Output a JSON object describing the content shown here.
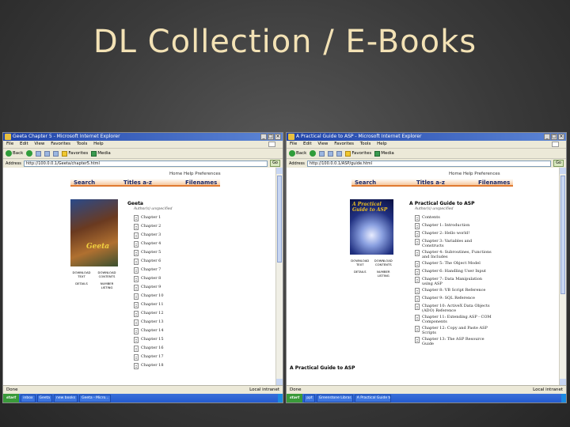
{
  "slide": {
    "title": "DL Collection / E-Books"
  },
  "browser_common": {
    "menu": [
      "File",
      "Edit",
      "View",
      "Favorites",
      "Tools",
      "Help"
    ],
    "toolbar": {
      "back": "Back",
      "favorites": "Favorites",
      "media": "Media"
    },
    "status": "Done",
    "zone": "Local intranet",
    "start": "start",
    "go": "Go"
  },
  "left": {
    "window_title": "Geeta Chapter 5 - Microsoft Internet Explorer",
    "address": "http://100.0.0.1/Geeta/chapter5.html",
    "nav_help": "Home  Help  Preferences",
    "tabs": [
      "Search",
      "Titles a-z",
      "Filenames"
    ],
    "cover_title": "Geeta",
    "actions": [
      "DOWNLOAD TEXT",
      "DOWNLOAD CONTENTS",
      "DETAILS",
      "NUMBER LISTING"
    ],
    "book_title": "Geeta",
    "book_author": "Author(s) unspecified",
    "chapters": [
      "Chapter 1",
      "Chapter 2",
      "Chapter 3",
      "Chapter 4",
      "Chapter 5",
      "Chapter 6",
      "Chapter 7",
      "Chapter 8",
      "Chapter 9",
      "Chapter 10",
      "Chapter 11",
      "Chapter 12",
      "Chapter 13",
      "Chapter 14",
      "Chapter 15",
      "Chapter 16",
      "Chapter 17",
      "Chapter 18"
    ],
    "taskbar": [
      "inbox",
      "Geeta",
      "new books",
      "Geeta - Micro..."
    ]
  },
  "right": {
    "window_title": "A Practical Guide to ASP - Microsoft Internet Explorer",
    "address": "http://100.0.0.1/ASP/guide.html",
    "nav_help": "Home  Help  Preferences",
    "tabs": [
      "Search",
      "Titles a-z",
      "Filenames"
    ],
    "cover_title": "A Practical Guide to ASP",
    "actions": [
      "DOWNLOAD TEXT",
      "DOWNLOAD CONTENTS",
      "DETAILS",
      "NUMBER LISTING"
    ],
    "book_title": "A Practical Guide to ASP",
    "book_author": "Author(s) unspecified",
    "chapters": [
      "Contents",
      "Chapter 1: Introduction",
      "Chapter 2: Hello world!",
      "Chapter 3: Variables and Constructs",
      "Chapter 4: Subroutines, Functions and Includes",
      "Chapter 5: The Object Model",
      "Chapter 6: Handling User Input",
      "Chapter 7: Data Manipulation using ASP",
      "Chapter 8: VB Script Reference",
      "Chapter 9: SQL Reference",
      "Chapter 10: ActiveX Data Objects (ADO) Reference",
      "Chapter 11: Extending ASP - COM Components",
      "Chapter 12: Copy and Paste ASP Scripts",
      "Chapter 13: The ASP Resource Guide"
    ],
    "bottom_title": "A Practical Guide to ASP",
    "taskbar": [
      "ppt",
      "Greenstone Librar...",
      "A Practical Guide to A..."
    ]
  }
}
